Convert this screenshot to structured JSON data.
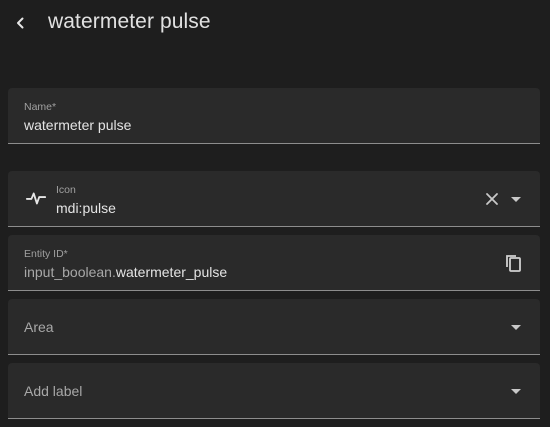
{
  "header": {
    "title": "watermeter pulse"
  },
  "form": {
    "name": {
      "label": "Name*",
      "value": "watermeter pulse"
    },
    "icon": {
      "label": "Icon",
      "value": "mdi:pulse",
      "icon_name": "pulse-icon"
    },
    "entity_id": {
      "label": "Entity ID*",
      "prefix": "input_boolean.",
      "value": "watermeter_pulse"
    },
    "area": {
      "placeholder": "Area"
    },
    "labels": {
      "placeholder": "Add label"
    }
  },
  "colors": {
    "background": "#1e1e1e",
    "field_background": "#2a2a2a",
    "text": "#e1e1e1",
    "secondary_text": "#a0a0a0"
  }
}
